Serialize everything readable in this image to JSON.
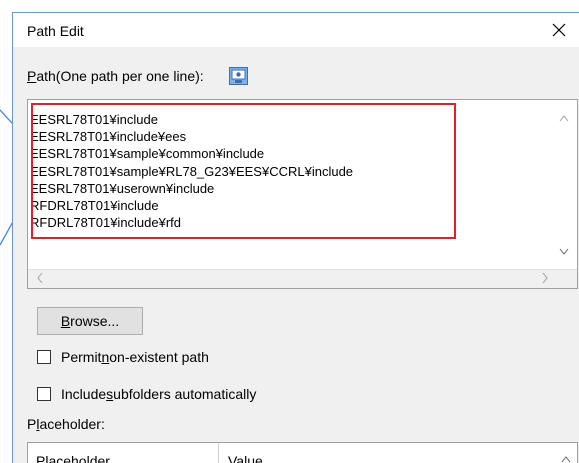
{
  "window": {
    "title": "Path Edit",
    "close_icon": "close-icon"
  },
  "path_label": {
    "accel": "P",
    "rest": "ath(One path per one line):"
  },
  "paths": [
    "EESRL78T01¥include",
    "EESRL78T01¥include¥ees",
    "EESRL78T01¥sample¥common¥include",
    "EESRL78T01¥sample¥RL78_G23¥EES¥CCRL¥include",
    "EESRL78T01¥userown¥include",
    "RFDRL78T01¥include",
    "RFDRL78T01¥include¥rfd"
  ],
  "browse": {
    "accel": "B",
    "rest": "rowse..."
  },
  "options": {
    "permit": {
      "pre": "Permit ",
      "accel": "n",
      "post": "on-existent path",
      "checked": false
    },
    "include_sub": {
      "pre": "Include ",
      "accel": "s",
      "post": "ubfolders automatically",
      "checked": false
    }
  },
  "placeholder": {
    "label_pre": "P",
    "label_accel": "l",
    "label_post": "aceholder:",
    "columns": [
      "Placeholder",
      "Value"
    ]
  },
  "colors": {
    "highlight": "#e0202a",
    "callout": "#4a8ad4"
  }
}
